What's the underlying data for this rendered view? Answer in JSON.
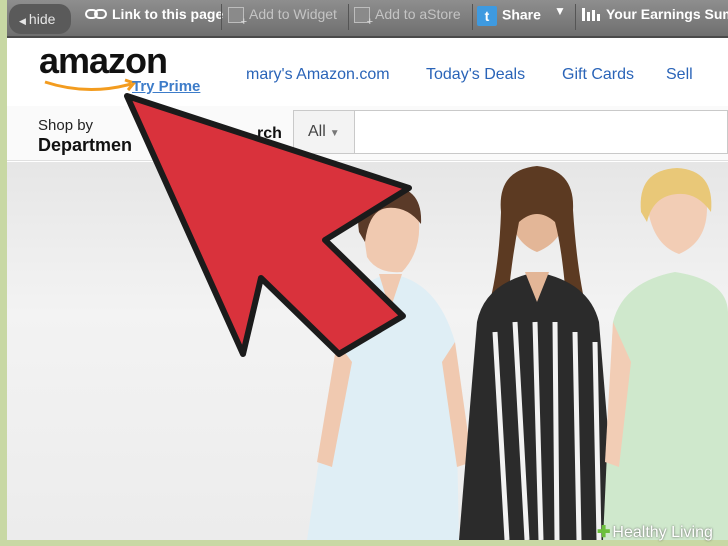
{
  "toolbar": {
    "hide_label": "hide",
    "link_label": "Link to this page",
    "widget_label": "Add to Widget",
    "astore_label": "Add to aStore",
    "share_label": "Share",
    "earnings_label": "Your Earnings Summ",
    "icons": [
      "link-icon",
      "widget-icon",
      "astore-icon",
      "twitter-icon",
      "earnings-chart-icon"
    ]
  },
  "header": {
    "logo_text": "amazon",
    "prime_link": "Try Prime",
    "nav_links": [
      "mary's Amazon.com",
      "Today's Deals",
      "Gift Cards",
      "Sell"
    ]
  },
  "nav": {
    "shop_by": "Shop by",
    "department": "Departmen",
    "search_label": "rch",
    "search_scope": "All"
  },
  "overlay": {
    "arrow_color": "#d9323c",
    "watermark_brand": "Healthy Living"
  },
  "colors": {
    "toolbar_bg": "#7a7a7a",
    "link_blue": "#2a64b8",
    "prime_blue": "#3d7cc9",
    "border_green": "#c8d8a4"
  }
}
